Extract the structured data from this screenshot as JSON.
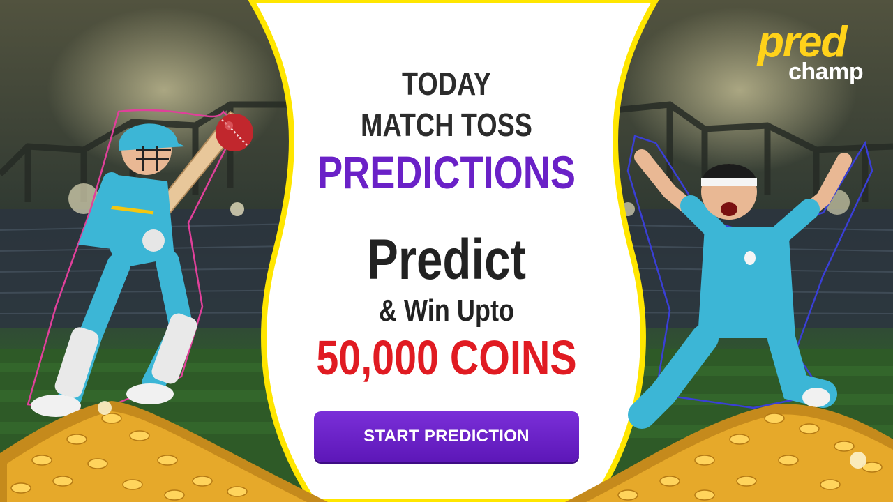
{
  "brand": {
    "logo_primary": "pred",
    "logo_secondary": "champ",
    "logo_color": "#ffd21a"
  },
  "headline": {
    "line1": "TODAY",
    "line2": "MATCH TOSS",
    "line3": "PREDICTIONS",
    "line4": "Predict",
    "line5": "& Win Upto",
    "line6": "50,000 COINS"
  },
  "cta": {
    "label": "START PREDICTION",
    "color": "#6a21c7"
  },
  "colors": {
    "accent_purple": "#6a21c7",
    "accent_red": "#e01b22",
    "panel_edge_yellow": "#ffe600",
    "jersey": "#34b7d4"
  },
  "icons": {
    "batsman": "cricket-batsman-illustration",
    "bowler": "cricket-bowler-celebrating-illustration",
    "ball": "cricket-ball-icon",
    "coins": "gold-coin-pile-icon"
  }
}
